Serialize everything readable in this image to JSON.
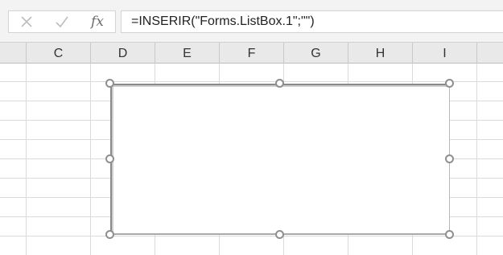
{
  "formula_bar": {
    "cancel_icon": "close-icon",
    "enter_icon": "check-icon",
    "fx_label": "fx",
    "formula": "=INSERIR(\"Forms.ListBox.1\";\"\")"
  },
  "columns": [
    "C",
    "D",
    "E",
    "F",
    "G",
    "H",
    "I"
  ],
  "control": {
    "type": "listbox",
    "selected": true
  },
  "colors": {
    "header_bg": "#e9e9e9",
    "gridline": "#dadada",
    "handle": "#8f8f8f"
  }
}
